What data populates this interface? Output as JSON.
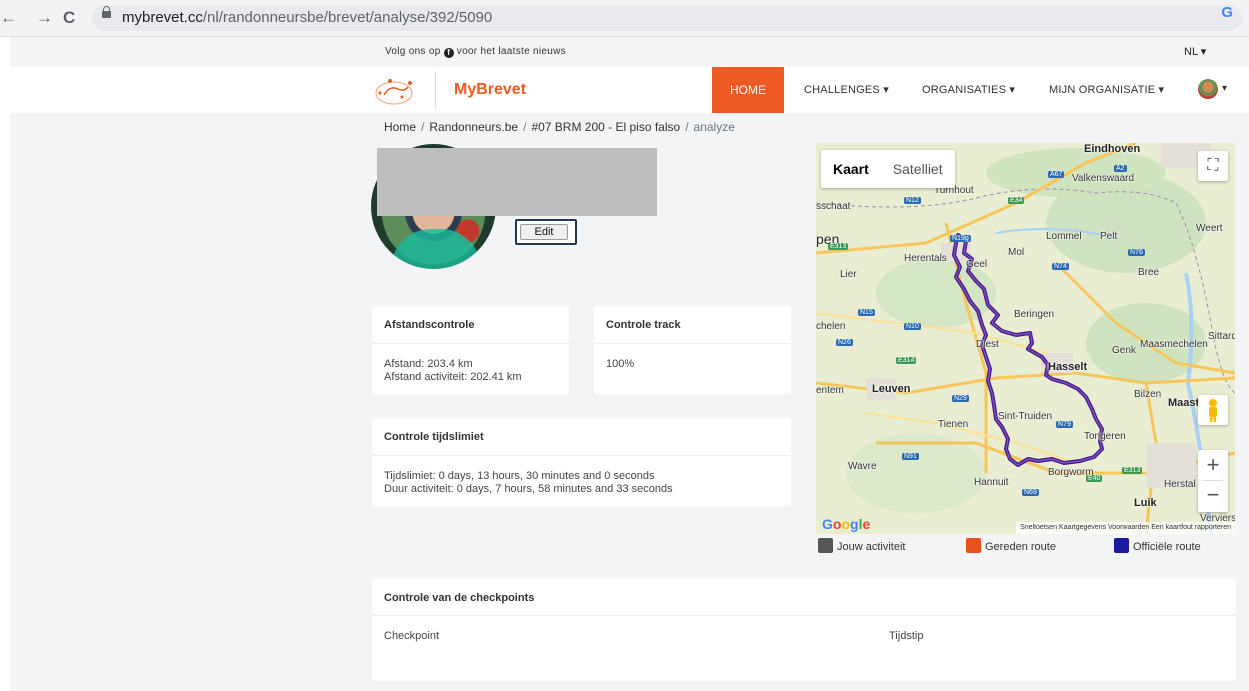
{
  "browser": {
    "nav_back": "←",
    "nav_forward": "→",
    "nav_reload": "C",
    "url_host": "mybrevet.cc",
    "url_path": "/nl/randonneursbe/brevet/analyse/392/5090",
    "profile_letter": "G"
  },
  "topbar": {
    "follow_pre": "Volg ons op",
    "follow_post": "voor het laatste nieuws",
    "fb_letter": "f",
    "lang": "NL ▾"
  },
  "nav": {
    "brand": "MyBrevet",
    "home": "HOME",
    "challenges": "CHALLENGES ▾",
    "organisaties": "ORGANISATIES ▾",
    "mijn_organisatie": "MIJN ORGANISATIE ▾",
    "user_caret": "▾"
  },
  "breadcrumb": {
    "home": "Home",
    "club": "Randonneurs.be",
    "event": "#07 BRM 200 - El piso falso",
    "current": "analyze",
    "sep": "/"
  },
  "profile": {
    "edit_label": "Edit"
  },
  "cards": {
    "afstand": {
      "title": "Afstandscontrole",
      "line1": "Afstand: 203.4 km",
      "line2": "Afstand activiteit: 202.41 km"
    },
    "track": {
      "title": "Controle track",
      "value": "100%"
    },
    "tijd": {
      "title": "Controle tijdslimiet",
      "line1": "Tijdslimiet: 0 days, 13 hours, 30 minutes and 0 seconds",
      "line2": "Duur activiteit: 0 days, 7 hours, 58 minutes and 33 seconds"
    },
    "checkpoints": {
      "title": "Controle van de checkpoints",
      "col_checkpoint": "Checkpoint",
      "col_tijdstip": "Tijdstip"
    }
  },
  "map": {
    "tab_kaart": "Kaart",
    "tab_satelliet": "Satelliet",
    "fullscreen": "⛶",
    "zoom_in": "+",
    "zoom_out": "−",
    "google": "Google",
    "footer": "Sneltoetsen  Kaartgegevens  Voorwaarden  Een kaartfout rapporteren",
    "labels": {
      "eindhoven": "Eindhoven",
      "valkenswaard": "Valkenswaard",
      "turnhout": "Turnhout",
      "asschaat": "sschaat",
      "weert": "Weert",
      "lommel": "Lommel",
      "pelt": "Pelt",
      "pen": "pen",
      "herentals": "Herentals",
      "mol": "Mol",
      "geel": "Geel",
      "bree": "Bree",
      "lier": "Lier",
      "beringen": "Beringen",
      "mechelen": "chelen",
      "diest": "Diest",
      "genk": "Genk",
      "maasmechelen": "Maasmechelen",
      "sittard": "Sittard",
      "hasselt": "Hasselt",
      "bilzen": "Bilzen",
      "maastricht": "Maastricht",
      "leuven": "Leuven",
      "sinttruiden": "Sint-Truiden",
      "tienen": "Tienen",
      "tongeren": "Tongeren",
      "wavre": "Wavre",
      "hannuit": "Hannuit",
      "borgworm": "Borgworm",
      "herstal": "Herstal",
      "luik": "Luik",
      "verviers": "Verviers",
      "entem": "entem"
    }
  },
  "legend": {
    "jouw": "Jouw activiteit",
    "gereden": "Gereden route",
    "officiele": "Officiële route",
    "colors": {
      "jouw": "#555555",
      "gereden": "#e8501c",
      "officiele": "#1a1aa0"
    }
  },
  "colors": {
    "accent": "#ee5a24",
    "route": "#4b1a8a"
  }
}
